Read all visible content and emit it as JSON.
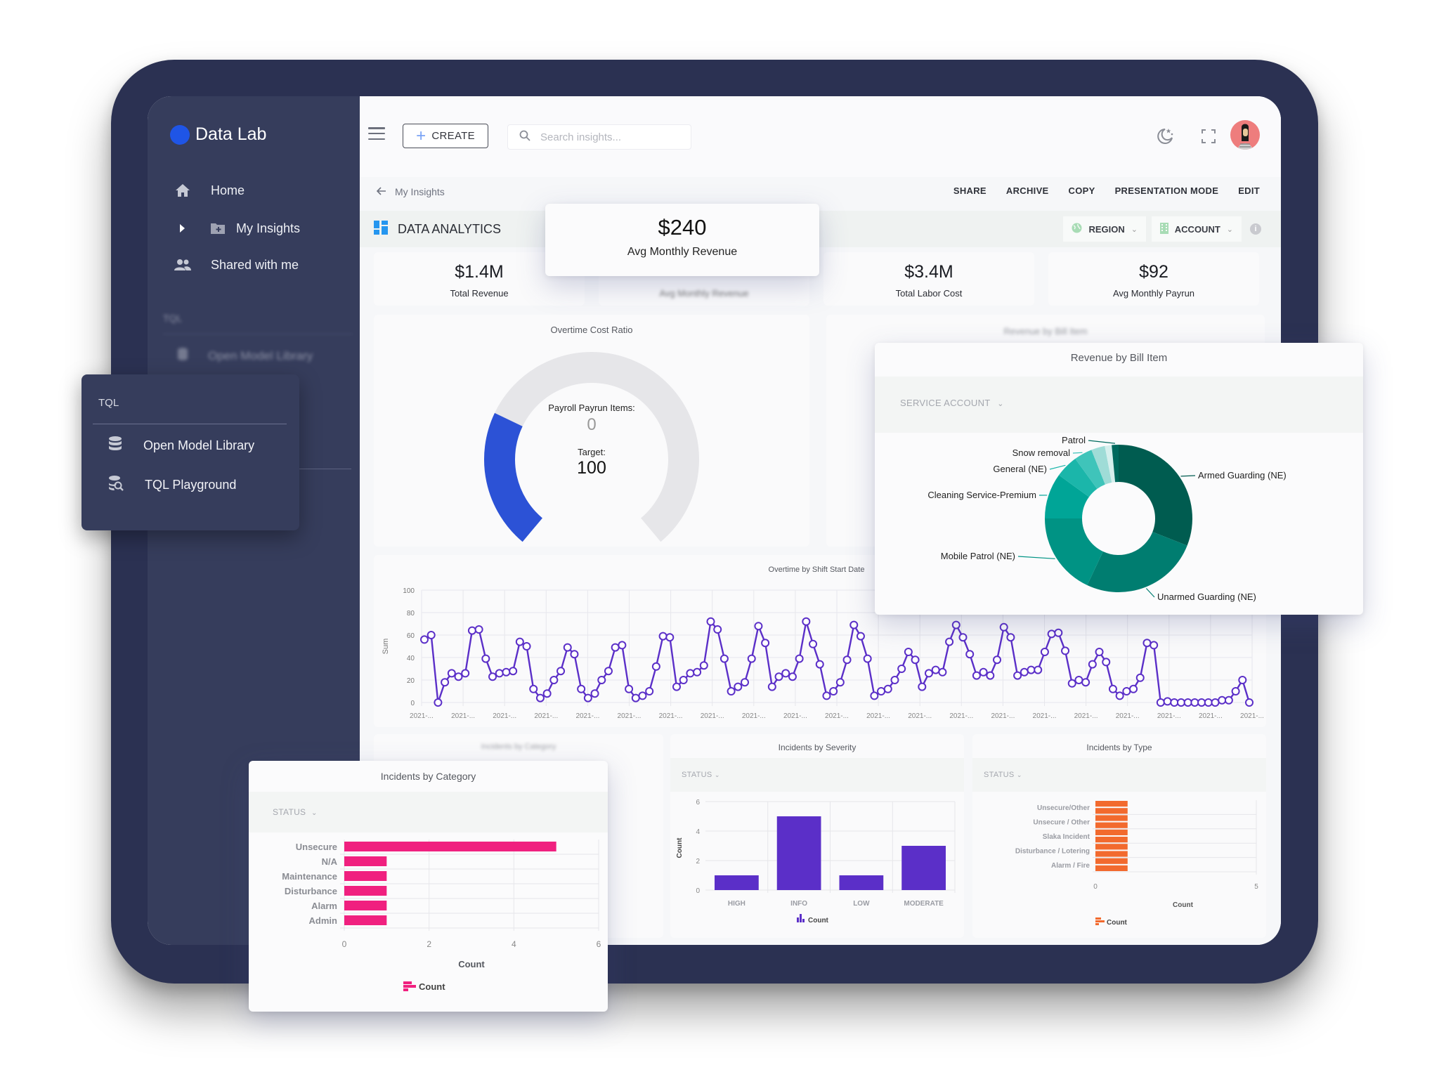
{
  "app": {
    "name": "Data Lab",
    "brand_color": "#1f55e6"
  },
  "sidebar": {
    "items": [
      {
        "label": "Home",
        "icon": "home-icon"
      },
      {
        "label": "My Insights",
        "icon": "folder-plus-icon",
        "expand_icon": "caret-right-icon"
      },
      {
        "label": "Shared with me",
        "icon": "people-icon"
      }
    ],
    "section": "TQL",
    "section_items": [
      {
        "label": "Open Model Library",
        "icon": "database-icon"
      }
    ]
  },
  "tql_menu": {
    "header": "TQL",
    "items": [
      {
        "label": "Open Model Library",
        "icon": "database-icon"
      },
      {
        "label": "TQL Playground",
        "icon": "database-search-icon"
      }
    ]
  },
  "topbar": {
    "create_label": "CREATE",
    "search_placeholder": "Search insights...",
    "icons": [
      "menu-icon",
      "dark-mode-icon",
      "fullscreen-icon",
      "avatar"
    ]
  },
  "breadcrumb": {
    "back_label": "My Insights"
  },
  "actions": [
    "SHARE",
    "ARCHIVE",
    "COPY",
    "PRESENTATION MODE",
    "EDIT"
  ],
  "dashboard": {
    "title": "DATA ANALYTICS",
    "filters": [
      {
        "label": "REGION",
        "icon": "globe-icon"
      },
      {
        "label": "ACCOUNT",
        "icon": "building-icon"
      }
    ]
  },
  "kpis": [
    {
      "value": "$1.4M",
      "label": "Total Revenue"
    },
    {
      "value": "$240",
      "label": "Avg Monthly Revenue"
    },
    {
      "value": "$3.4M",
      "label": "Total Labor Cost"
    },
    {
      "value": "$92",
      "label": "Avg Monthly Payrun"
    }
  ],
  "kpi_highlight": {
    "value": "$240",
    "label": "Avg Monthly Revenue"
  },
  "gauge": {
    "title": "Overtime Cost Ratio",
    "label": "Payroll Payrun Items:",
    "value": "0",
    "target_label": "Target:",
    "target": "100",
    "fill_fraction": 0.27,
    "fill_color": "#2c52d6",
    "track_color": "#e6e6e9"
  },
  "chart_data": [
    {
      "type": "pie",
      "title": "Revenue by Bill Item",
      "filter_label": "SERVICE ACCOUNT",
      "donut": true,
      "slices": [
        {
          "label": "Armed Guarding (NE)",
          "value": 31,
          "color": "#005c50"
        },
        {
          "label": "Unarmed Guarding (NE)",
          "value": 26,
          "color": "#007d70"
        },
        {
          "label": "Mobile Patrol (NE)",
          "value": 18,
          "color": "#009384"
        },
        {
          "label": "Cleaning Service-Premium",
          "value": 10,
          "color": "#00a597"
        },
        {
          "label": "General (NE)",
          "value": 5,
          "color": "#1bb6aa"
        },
        {
          "label": "Snow removal",
          "value": 4,
          "color": "#3fc4ba"
        },
        {
          "label": "",
          "value": 3,
          "color": "#9fdcd7"
        },
        {
          "label": "",
          "value": 1.5,
          "color": "#d6efed"
        },
        {
          "label": "Patrol",
          "value": 1.5,
          "color": "#00695d"
        }
      ]
    },
    {
      "type": "line",
      "title": "Overtime by Shift Start Date",
      "xlabel": "",
      "ylabel": "Sum",
      "ylim": [
        0,
        100
      ],
      "yticks": [
        0,
        20,
        40,
        60,
        80,
        100
      ],
      "xtick_label": "2021-...",
      "xtick_count": 21,
      "color": "#5b2fc8",
      "grid": true,
      "values": [
        56,
        60,
        0,
        18,
        26,
        23,
        26,
        64,
        65,
        39,
        23,
        26,
        27,
        28,
        54,
        50,
        12,
        4,
        8,
        20,
        28,
        49,
        43,
        12,
        4,
        8,
        20,
        28,
        49,
        51,
        12,
        4,
        6,
        10,
        32,
        59,
        58,
        14,
        20,
        26,
        27,
        33,
        72,
        65,
        39,
        10,
        14,
        18,
        39,
        68,
        53,
        14,
        23,
        26,
        23,
        39,
        72,
        52,
        34,
        6,
        10,
        18,
        38,
        69,
        59,
        39,
        6,
        10,
        12,
        20,
        30,
        45,
        38,
        14,
        26,
        29,
        27,
        54,
        69,
        58,
        43,
        24,
        27,
        24,
        38,
        67,
        58,
        24,
        27,
        29,
        29,
        45,
        61,
        62,
        46,
        17,
        20,
        18,
        34,
        45,
        36,
        12,
        6,
        10,
        12,
        22,
        53,
        51,
        0,
        1,
        0,
        0,
        0,
        0,
        0,
        0,
        0,
        2,
        2,
        10,
        20,
        0
      ]
    },
    {
      "type": "bar",
      "orientation": "horizontal",
      "title": "Incidents by Category",
      "filter_label": "STATUS",
      "categories": [
        "Unsecure",
        "N/A",
        "Maintenance",
        "Disturbance",
        "Alarm",
        "Admin"
      ],
      "values": [
        5,
        1,
        1,
        1,
        1,
        1
      ],
      "xlabel": "Count",
      "xlim": [
        0,
        6
      ],
      "xticks": [
        0,
        2,
        4,
        6
      ],
      "legend": "Count",
      "legend_position": "bottom",
      "color": "#f0207f"
    },
    {
      "type": "bar",
      "title": "Incidents by Severity",
      "filter_label": "STATUS",
      "categories": [
        "HIGH",
        "INFO",
        "LOW",
        "MODERATE"
      ],
      "values": [
        1,
        5,
        1,
        3
      ],
      "ylabel": "Count",
      "ylim": [
        0,
        6
      ],
      "yticks": [
        0,
        2,
        4,
        6
      ],
      "legend": "Count",
      "legend_position": "bottom",
      "color": "#5b2fc8"
    },
    {
      "type": "bar",
      "orientation": "horizontal",
      "title": "Incidents by Type",
      "filter_label": "STATUS",
      "categories": [
        "Unsecure/Other",
        "Unsecure / Other",
        "Slaka Incident",
        "Disturbance / Lotering",
        "Alarm / Fire"
      ],
      "bar_count": 10,
      "values": [
        1,
        1,
        1,
        1,
        1,
        1,
        1,
        1,
        1,
        1
      ],
      "xlabel": "Count",
      "xlim": [
        0,
        5
      ],
      "xticks": [
        0,
        5
      ],
      "legend": "Count",
      "legend_position": "bottom",
      "color": "#f26a2e"
    }
  ]
}
